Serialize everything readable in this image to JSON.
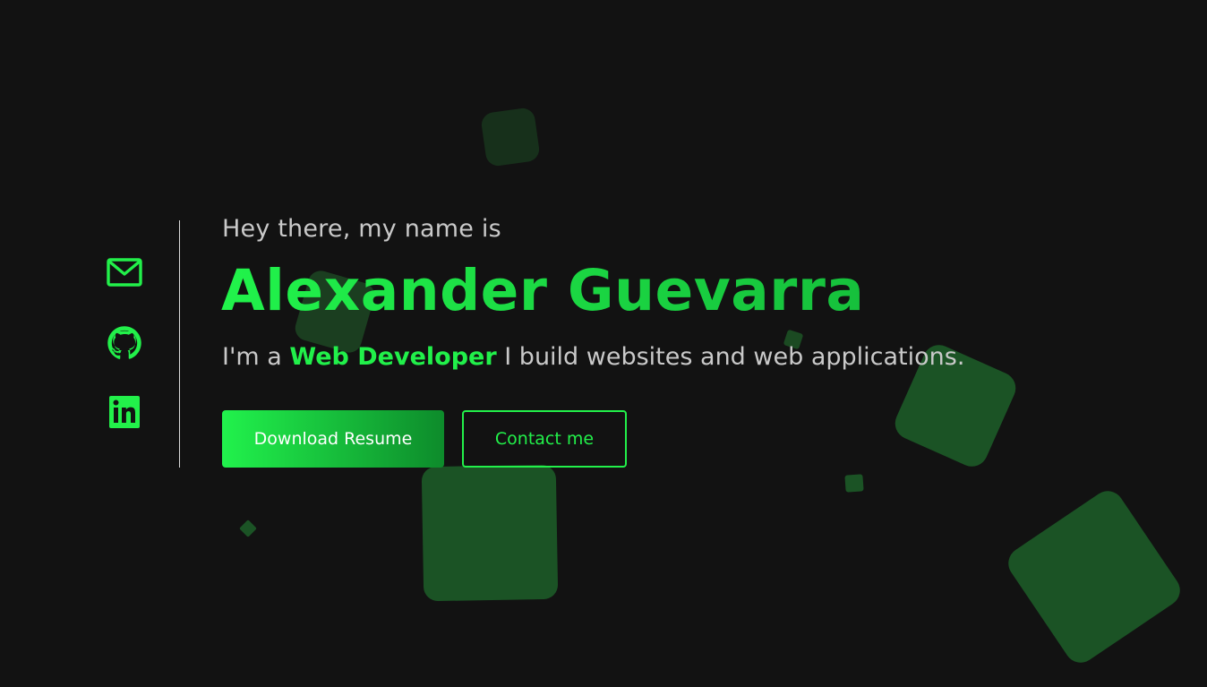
{
  "socials": [
    {
      "label": "Email",
      "icon": "mail-icon"
    },
    {
      "label": "GitHub",
      "icon": "github-icon"
    },
    {
      "label": "LinkedIn",
      "icon": "linkedin-icon"
    }
  ],
  "hero": {
    "greeting": "Hey there, my name is",
    "name": "Alexander Guevarra",
    "tagline_prefix": "I'm a ",
    "role": "Web Developer",
    "tagline_suffix": " I build websites and web applications."
  },
  "buttons": {
    "primary": "Download Resume",
    "secondary": "Contact me"
  },
  "colors": {
    "accent": "#22f04a",
    "background": "#121212",
    "shape": "#1b5325"
  }
}
